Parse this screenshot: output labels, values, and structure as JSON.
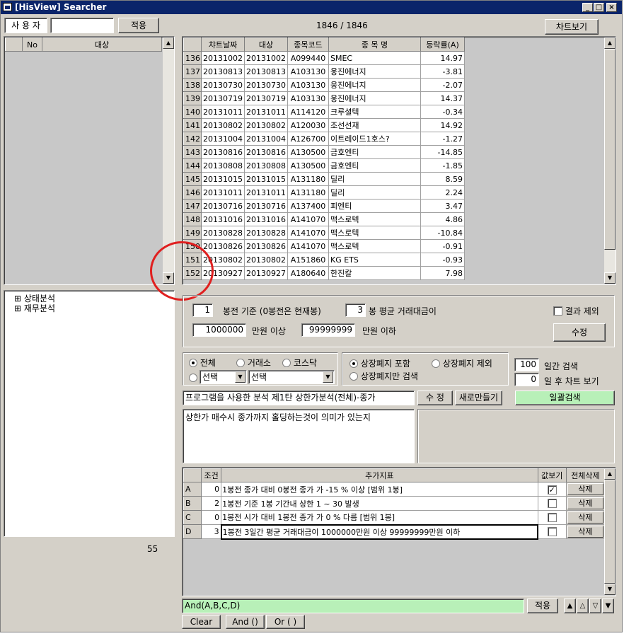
{
  "window": {
    "title": "[HisView] Searcher",
    "min": "_",
    "max": "□",
    "close": "×"
  },
  "user": {
    "label": "사 용 자",
    "value": "",
    "apply": "적용"
  },
  "counter": "1846 / 1846",
  "chart_btn": "차트보기",
  "left_grid": {
    "headers": [
      "No",
      "대상"
    ]
  },
  "tree": [
    {
      "expander": "⊞",
      "label": "상태분석"
    },
    {
      "expander": "⊞",
      "label": "재무분석"
    }
  ],
  "left_count": "55",
  "results": {
    "headers": [
      "챠트날짜",
      "대상",
      "종목코드",
      "종 목 명",
      "등락률(A)"
    ],
    "rows": [
      [
        "136",
        "20131002",
        "20131002",
        "A099440",
        "SMEC",
        "14.97"
      ],
      [
        "137",
        "20130813",
        "20130813",
        "A103130",
        "웅진에너지",
        "-3.81"
      ],
      [
        "138",
        "20130730",
        "20130730",
        "A103130",
        "웅진에너지",
        "-2.07"
      ],
      [
        "139",
        "20130719",
        "20130719",
        "A103130",
        "웅진에너지",
        "14.37"
      ],
      [
        "140",
        "20131011",
        "20131011",
        "A114120",
        "크루셜텍",
        "-0.34"
      ],
      [
        "141",
        "20130802",
        "20130802",
        "A120030",
        "조선선재",
        "14.92"
      ],
      [
        "142",
        "20131004",
        "20131004",
        "A126700",
        "이트레이드1호스?",
        "-1.27"
      ],
      [
        "143",
        "20130816",
        "20130816",
        "A130500",
        "금호엔티",
        "-14.85"
      ],
      [
        "144",
        "20130808",
        "20130808",
        "A130500",
        "금호엔티",
        "-1.85"
      ],
      [
        "145",
        "20131015",
        "20131015",
        "A131180",
        "딜리",
        "8.59"
      ],
      [
        "146",
        "20131011",
        "20131011",
        "A131180",
        "딜리",
        "2.24"
      ],
      [
        "147",
        "20130716",
        "20130716",
        "A137400",
        "피엔티",
        "3.47"
      ],
      [
        "148",
        "20131016",
        "20131016",
        "A141070",
        "맥스로텍",
        "4.86"
      ],
      [
        "149",
        "20130828",
        "20130828",
        "A141070",
        "맥스로텍",
        "-10.84"
      ],
      [
        "150",
        "20130826",
        "20130826",
        "A141070",
        "맥스로텍",
        "-0.91"
      ],
      [
        "151",
        "20130802",
        "20130802",
        "A151860",
        "KG ETS",
        "-0.93"
      ],
      [
        "152",
        "20130927",
        "20130927",
        "A180640",
        "한진칼",
        "7.98"
      ]
    ]
  },
  "params": {
    "bong_value": "1",
    "bong_label": "봉전 기준 (0봉전은 현재봉)",
    "avg_value": "3",
    "avg_label": "봉 평균 거래대금이",
    "min_value": "1000000",
    "min_label": "만원 이상",
    "max_value": "99999999",
    "max_label": "만원 이하",
    "exclude_label": "결과 제외",
    "modify": "수정"
  },
  "market": {
    "all": "전체",
    "kospi": "거래소",
    "kosdaq": "코스닥",
    "select1": "선택",
    "select2": "선택"
  },
  "delist": {
    "include": "상장폐지 포함",
    "exclude": "상장폐지 제외",
    "only": "상장폐지만 검색"
  },
  "days": {
    "search_value": "100",
    "search_label": "일간 검색",
    "after_value": "0",
    "after_label": "일 후 차트 보기"
  },
  "program": {
    "name": "프로그램을 사용한 분석 제1탄 상한가분석(전체)-종가",
    "modify": "수 정",
    "new": "새로만들기",
    "batch": "일괄검색",
    "desc": "상한가 매수시 종가까지 홀딩하는것이 의미가 있는지"
  },
  "conditions": {
    "headers": [
      "조건",
      "추가지표",
      "값보기",
      "전체삭제"
    ],
    "rows": [
      {
        "key": "A",
        "num": "0",
        "text": "1봉전 종가 대비  0봉전 종가 가 -15 % 이상    [범위 1봉]",
        "checked": "✓",
        "del": "삭제"
      },
      {
        "key": "B",
        "num": "2",
        "text": "1봉전 기준 1봉 기간내  상한 1 ~ 30 발생",
        "checked": "",
        "del": "삭제"
      },
      {
        "key": "C",
        "num": "0",
        "text": "1봉전 시가 대비  1봉전 종가 가 0 % 다름    [범위 1봉]",
        "checked": "",
        "del": "삭제"
      },
      {
        "key": "D",
        "num": "3",
        "text": "1봉전 3일간 평균 거래대금이 1000000만원 이상 99999999만원 이하",
        "checked": "",
        "del": "삭제"
      }
    ]
  },
  "formula": {
    "value": "And(A,B,C,D)",
    "apply": "적용"
  },
  "arrows": [
    "▲",
    "△",
    "▽",
    "▼"
  ],
  "bottom": {
    "clear": "Clear",
    "and": "And ()",
    "or": "Or ( )"
  }
}
